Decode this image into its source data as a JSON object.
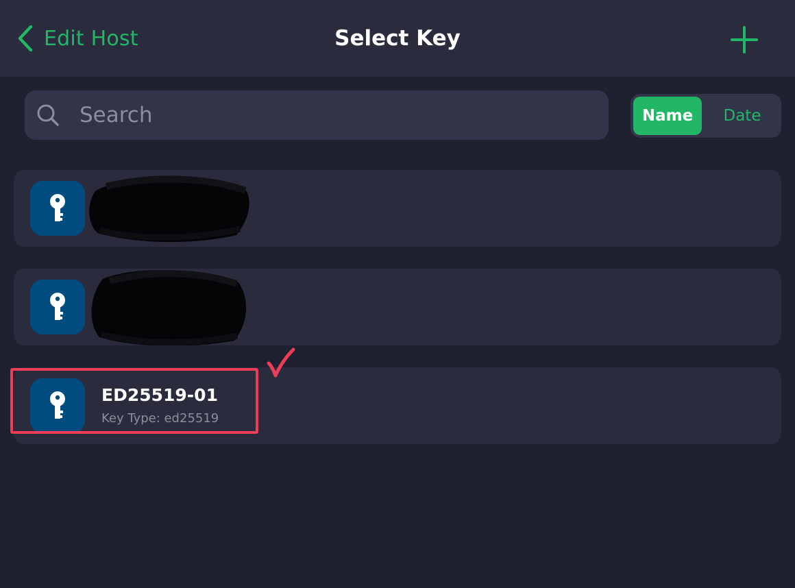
{
  "navbar": {
    "back_label": "Edit Host",
    "title": "Select Key"
  },
  "search": {
    "placeholder": "Search",
    "value": ""
  },
  "sort": {
    "options": [
      "Name",
      "Date"
    ],
    "selected": "Name"
  },
  "keys": [
    {
      "title": "",
      "subtitle": "",
      "redacted": true
    },
    {
      "title": "",
      "subtitle": "",
      "redacted": true
    },
    {
      "title": "ED25519-01",
      "subtitle": "Key Type: ed25519",
      "redacted": false,
      "highlighted": true
    }
  ],
  "colors": {
    "accent": "#22b667",
    "background": "#1f2131",
    "surface": "#2a2c3d",
    "key_tile": "#014c7e",
    "annotation": "#ee3d57"
  },
  "icons": {
    "back": "chevron-left-icon",
    "add": "plus-icon",
    "search": "search-icon",
    "key": "key-icon",
    "annotation": "checkmark-icon"
  }
}
